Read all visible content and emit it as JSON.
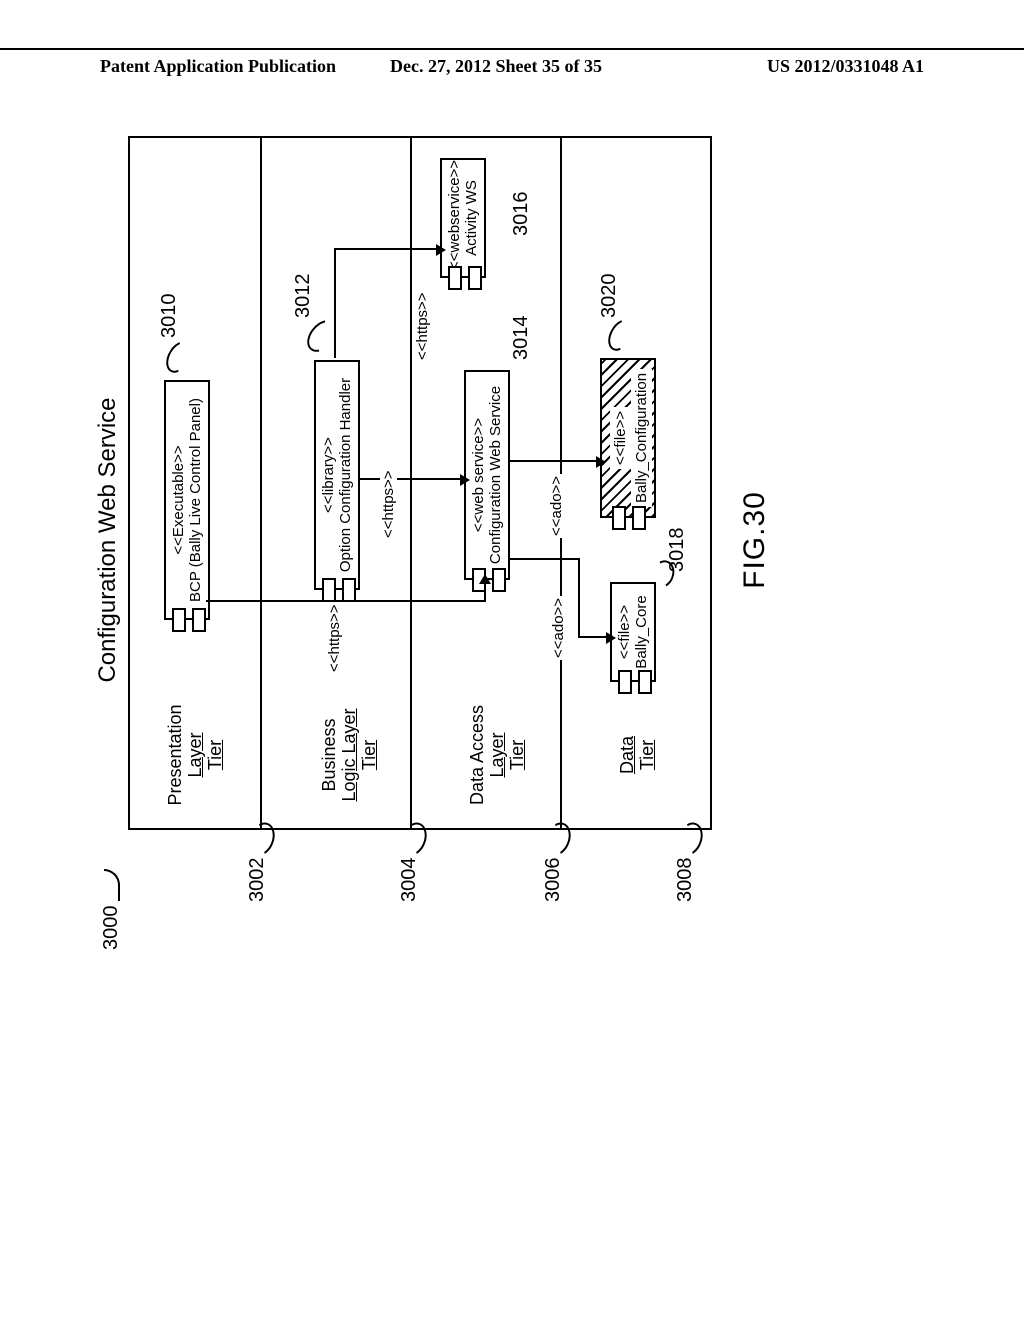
{
  "header": {
    "left": "Patent Application Publication",
    "center": "Dec. 27, 2012  Sheet 35 of 35",
    "right": "US 2012/0331048 A1"
  },
  "title": "Configuration Web Service",
  "figure_label": "FIG.30",
  "ref_labels": {
    "r3000": "3000",
    "r3002": "3002",
    "r3004": "3004",
    "r3006": "3006",
    "r3008": "3008",
    "r3010": "3010",
    "r3012": "3012",
    "r3014": "3014",
    "r3016": "3016",
    "r3018": "3018",
    "r3020": "3020"
  },
  "tiers": {
    "t1a": "Presentation",
    "t1b": "Layer",
    "t1c": "Tier",
    "t2a": "Business",
    "t2b": "Logic Layer",
    "t2c": "Tier",
    "t3a": "Data Access",
    "t3b": "Layer",
    "t3c": "Tier",
    "t4a": "Data",
    "t4b": "Tier"
  },
  "components": {
    "c3010s": "<<Executable>>",
    "c3010n": "BCP (Bally Live Control Panel)",
    "c3012s": "<<library>>",
    "c3012n": "Option Configuration Handler",
    "c3014s": "<<web service>>",
    "c3014n": "Configuration Web Service",
    "c3016s": "<<webservice>>",
    "c3016n": "Activity WS",
    "c3018s": "<<file>>",
    "c3018n": "Bally_Core",
    "c3020s": "<<file>>",
    "c3020n": "Bally_Configuration"
  },
  "conn": {
    "https": "<<https>>",
    "ado": "<<ado>>"
  }
}
